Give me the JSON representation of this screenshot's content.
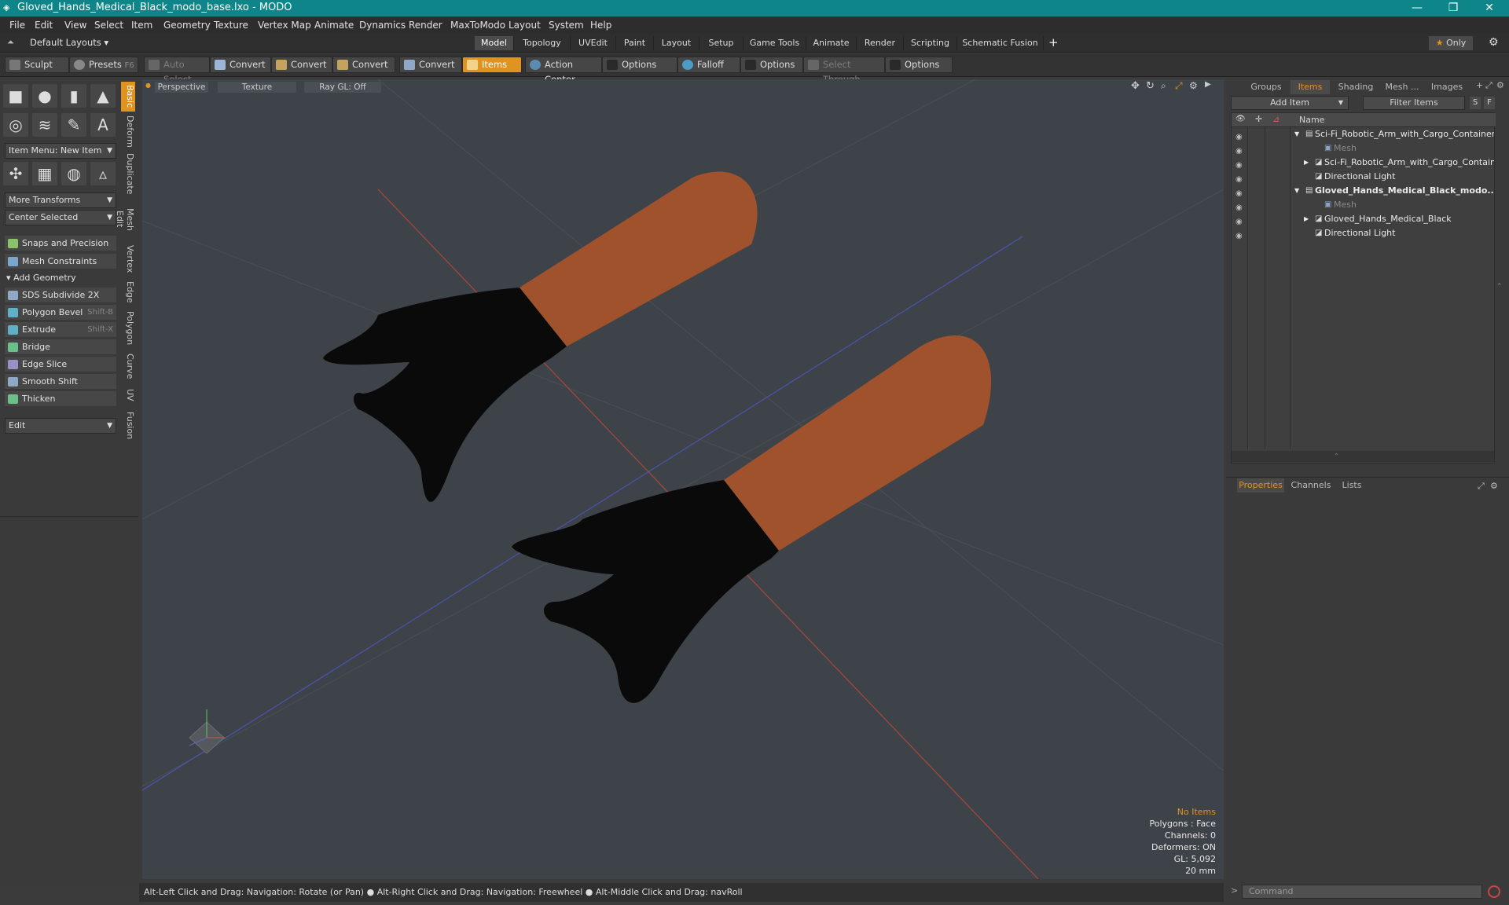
{
  "window": {
    "title": "Gloved_Hands_Medical_Black_modo_base.lxo - MODO",
    "controls": [
      "—",
      "❐",
      "✕"
    ]
  },
  "menu": [
    "File",
    "Edit",
    "View",
    "Select",
    "Item",
    "Geometry",
    "Texture",
    "Vertex Map",
    "Animate",
    "Dynamics",
    "Render",
    "MaxToModo",
    "Layout",
    "System",
    "Help"
  ],
  "layoutbar": {
    "layout_label": "Default Layouts",
    "tabs": [
      "Model",
      "Topology",
      "UVEdit",
      "Paint",
      "Layout",
      "Setup",
      "Game Tools",
      "Animate",
      "Render",
      "Scripting",
      "Schematic Fusion"
    ],
    "active_tab": "Model",
    "add": "+",
    "only": "Only"
  },
  "toolbar": {
    "sculpt": "Sculpt",
    "presets": "Presets",
    "presets_key": "F6",
    "auto_select": "Auto Select",
    "convert": "Convert",
    "items": "Items",
    "action_center": "Action Center",
    "options": "Options",
    "falloff": "Falloff",
    "select_through": "Select Through"
  },
  "leftpanel": {
    "item_menu": "Item Menu: New Item",
    "more_transforms": "More Transforms",
    "center_selected": "Center Selected",
    "snaps": "Snaps and Precision",
    "mesh_constraints": "Mesh Constraints",
    "add_geometry": "Add Geometry",
    "tools": [
      {
        "label": "SDS Subdivide 2X",
        "shortcut": ""
      },
      {
        "label": "Polygon Bevel",
        "shortcut": "Shift-B"
      },
      {
        "label": "Extrude",
        "shortcut": "Shift-X"
      },
      {
        "label": "Bridge",
        "shortcut": ""
      },
      {
        "label": "Edge Slice",
        "shortcut": ""
      },
      {
        "label": "Smooth Shift",
        "shortcut": ""
      },
      {
        "label": "Thicken",
        "shortcut": ""
      }
    ],
    "edit": "Edit",
    "vtabs": [
      "Basic",
      "Deform",
      "Duplicate",
      "Mesh Edit",
      "Vertex",
      "Edge",
      "Polygon",
      "Curve",
      "UV",
      "Fusion"
    ]
  },
  "viewport": {
    "perspective": "Perspective",
    "texture": "Texture",
    "raygl": "Ray GL: Off",
    "info": {
      "no_items": "No Items",
      "polygons": "Polygons : Face",
      "channels": "Channels: 0",
      "deformers": "Deformers: ON",
      "gl": "GL: 5,092",
      "scale": "20 mm"
    }
  },
  "statusbar": "Alt-Left Click and Drag: Navigation: Rotate (or Pan) ● Alt-Right Click and Drag: Navigation: Freewheel ● Alt-Middle Click and Drag: navRoll",
  "rightpanel": {
    "tabs": [
      "Groups",
      "Items",
      "Shading",
      "Mesh ...",
      "Images"
    ],
    "active_tab": "Items",
    "add_item": "Add Item",
    "filter": "Filter Items",
    "btn_s": "S",
    "btn_f": "F",
    "name_col": "Name",
    "tree": [
      {
        "label": "Sci-Fi_Robotic_Arm_with_Cargo_Container ...",
        "indent": 0,
        "bold": false,
        "dim": false,
        "arrow": "▼"
      },
      {
        "label": "Mesh",
        "indent": 2,
        "bold": false,
        "dim": true,
        "arrow": ""
      },
      {
        "label": "Sci-Fi_Robotic_Arm_with_Cargo_Container",
        "indent": 1,
        "bold": false,
        "dim": false,
        "arrow": "▶"
      },
      {
        "label": "Directional Light",
        "indent": 1,
        "bold": false,
        "dim": false,
        "arrow": ""
      },
      {
        "label": "Gloved_Hands_Medical_Black_modo...",
        "indent": 0,
        "bold": true,
        "dim": false,
        "arrow": "▼"
      },
      {
        "label": "Mesh",
        "indent": 2,
        "bold": false,
        "dim": true,
        "arrow": ""
      },
      {
        "label": "Gloved_Hands_Medical_Black",
        "indent": 1,
        "bold": false,
        "dim": false,
        "arrow": "▶"
      },
      {
        "label": "Directional Light",
        "indent": 1,
        "bold": false,
        "dim": false,
        "arrow": ""
      }
    ],
    "props_tabs": [
      "Properties",
      "Channels",
      "Lists"
    ],
    "props_active": "Properties",
    "command": "Command"
  }
}
